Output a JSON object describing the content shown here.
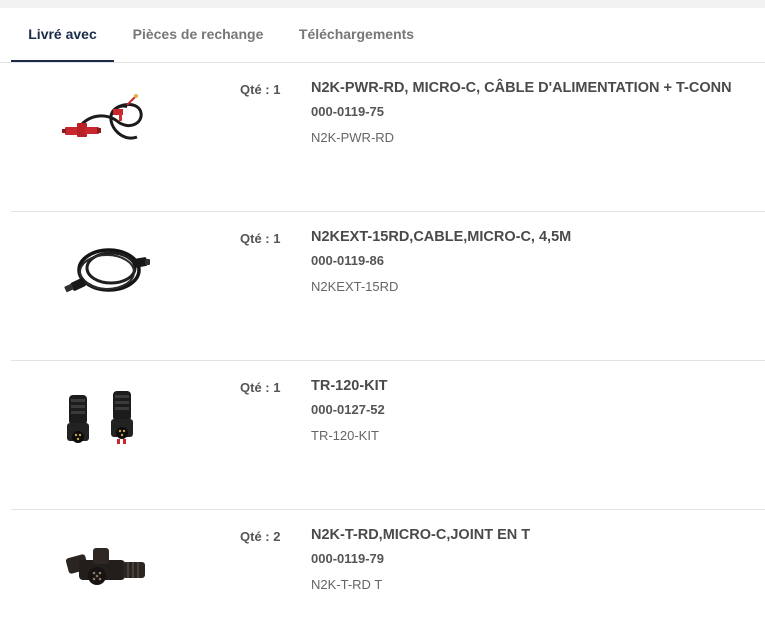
{
  "tabs": [
    {
      "label": "Livré avec"
    },
    {
      "label": "Pièces de rechange"
    },
    {
      "label": "Téléchargements"
    }
  ],
  "active_tab": "Livré avec",
  "items": [
    {
      "qty": "Qté : 1",
      "title": "N2K-PWR-RD, MICRO-C, CÂBLE D'ALIMENTATION + T-CONN",
      "part_number": "000-0119-75",
      "model": "N2K-PWR-RD",
      "image_icon": "power-cable-image"
    },
    {
      "qty": "Qté : 1",
      "title": "N2KEXT-15RD,CABLE,MICRO-C, 4,5M",
      "part_number": "000-0119-86",
      "model": "N2KEXT-15RD",
      "image_icon": "extension-cable-image"
    },
    {
      "qty": "Qté : 1",
      "title": "TR-120-KIT",
      "part_number": "000-0127-52",
      "model": "TR-120-KIT",
      "image_icon": "terminator-kit-image"
    },
    {
      "qty": "Qté : 2",
      "title": "N2K-T-RD,MICRO-C,JOINT EN T",
      "part_number": "000-0119-79",
      "model": "N2K-T-RD T",
      "image_icon": "t-joint-image"
    }
  ],
  "colors": {
    "accent": "#1a2b4a",
    "divider": "#e3e3e3",
    "background": "#f2f2f2",
    "connector_red": "#c8282d"
  }
}
